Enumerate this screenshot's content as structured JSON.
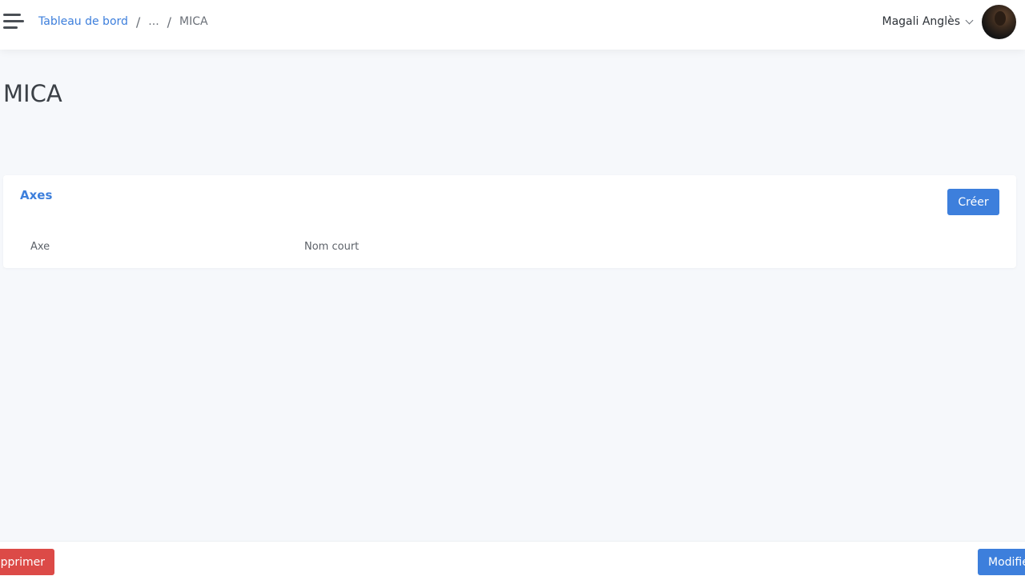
{
  "header": {
    "breadcrumb": {
      "home": "Tableau de bord",
      "separator": "/",
      "ellipsis": "...",
      "current": "MICA"
    },
    "user": {
      "name": "Magali Anglès"
    }
  },
  "page": {
    "title": "MICA"
  },
  "axes_card": {
    "title": "Axes",
    "create_label": "Créer",
    "columns": [
      "Axe",
      "Nom court"
    ],
    "rows": []
  },
  "footer": {
    "delete_label": "Supprimer",
    "edit_label": "Modifier"
  },
  "colors": {
    "accent": "#3d7fdc",
    "danger": "#dc4a47",
    "background": "#f6f8fb"
  }
}
